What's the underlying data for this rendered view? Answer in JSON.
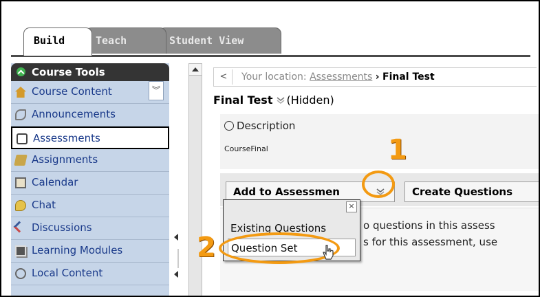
{
  "tabs": {
    "build": "Build",
    "teach": "Teach",
    "student": "Student View"
  },
  "sidebar": {
    "header": "Course Tools",
    "items": [
      {
        "label": "Course Content",
        "icon": "house-icon"
      },
      {
        "label": "Announcements",
        "icon": "announcement-icon"
      },
      {
        "label": "Assessments",
        "icon": "assessment-icon"
      },
      {
        "label": "Assignments",
        "icon": "assignment-icon"
      },
      {
        "label": "Calendar",
        "icon": "calendar-icon"
      },
      {
        "label": "Chat",
        "icon": "chat-icon"
      },
      {
        "label": "Discussions",
        "icon": "discussion-icon"
      },
      {
        "label": "Learning Modules",
        "icon": "learning-module-icon"
      },
      {
        "label": "Local Content",
        "icon": "local-content-icon"
      }
    ],
    "active": "Assessments"
  },
  "breadcrumb": {
    "prefix": "Your location:",
    "link": "Assessments",
    "sep": "›",
    "current": "Final Test"
  },
  "page": {
    "title": "Final Test",
    "status": "(Hidden)"
  },
  "description": {
    "heading": "Description",
    "text": "CourseFinal"
  },
  "toolbar": {
    "add_label": "Add to Assessmen",
    "create_label": "Create Questions"
  },
  "dropdown": {
    "close": "×",
    "option1": "Existing Questions",
    "option2": "Question Set"
  },
  "panel": {
    "line1": "o questions in this assess",
    "line2": "s for this assessment, use"
  },
  "callouts": {
    "one": "1",
    "two": "2"
  },
  "colors": {
    "callout": "#f39a12",
    "sidebar_bg": "#c6d5e8",
    "tab_active": "#ffffff",
    "tab_inactive": "#8c8c8c"
  }
}
